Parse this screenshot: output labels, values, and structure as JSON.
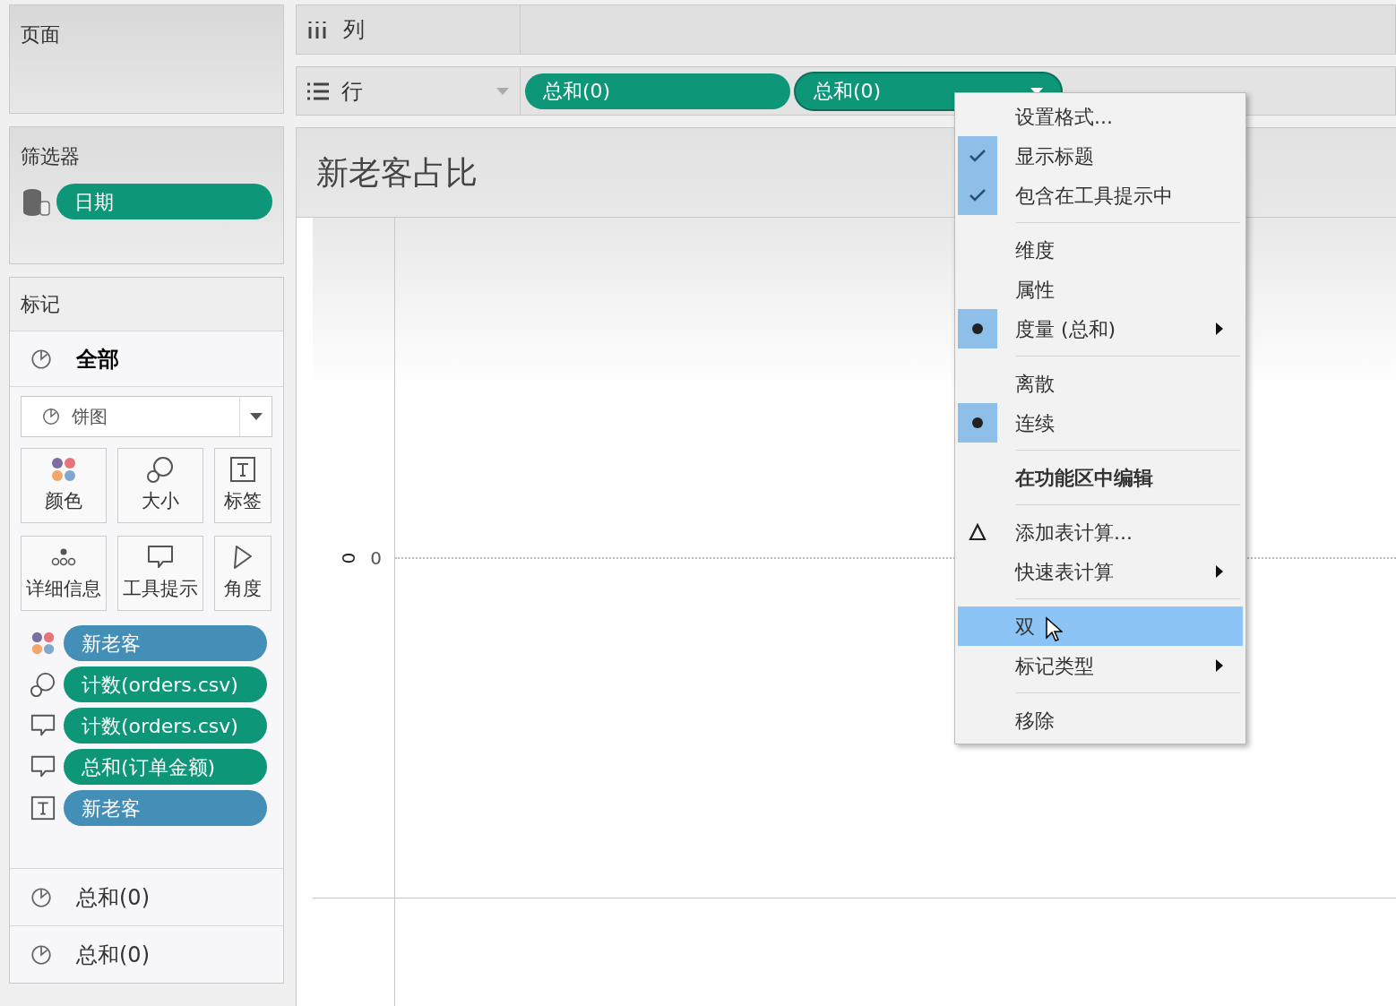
{
  "pages_card": {
    "title": "页面"
  },
  "filters_card": {
    "title": "筛选器",
    "pills": [
      {
        "text": "日期",
        "color": "#0e9679"
      }
    ]
  },
  "marks_card": {
    "title": "标记",
    "sections": [
      {
        "label": "全部",
        "selected": true
      },
      {
        "label": "总和(0)",
        "selected": false
      },
      {
        "label": "总和(0)",
        "selected": false
      }
    ],
    "mark_type": {
      "value": "饼图"
    },
    "properties": [
      {
        "kind": "color",
        "label": "颜色"
      },
      {
        "kind": "size",
        "label": "大小"
      },
      {
        "kind": "label",
        "label": "标签"
      },
      {
        "kind": "detail",
        "label": "详细信息"
      },
      {
        "kind": "tooltip",
        "label": "工具提示"
      },
      {
        "kind": "angle",
        "label": "角度"
      }
    ],
    "fields": [
      {
        "kind": "color",
        "text": "新老客",
        "color": "#448fb8"
      },
      {
        "kind": "size",
        "text": "计数(orders.csv)",
        "color": "#0e9679"
      },
      {
        "kind": "tooltip",
        "text": "计数(orders.csv)",
        "color": "#0e9679"
      },
      {
        "kind": "tooltip",
        "text": "总和(订单金额)",
        "color": "#0e9679"
      },
      {
        "kind": "label",
        "text": "新老客",
        "color": "#448fb8"
      }
    ]
  },
  "columns_shelf": {
    "label": "列"
  },
  "rows_shelf": {
    "label": "行",
    "pills": [
      {
        "text": "总和(0)",
        "color": "#0e9679",
        "menu_open": false
      },
      {
        "text": "总和(0)",
        "color": "#0e9679",
        "menu_open": true
      }
    ]
  },
  "view": {
    "title": "新老客占比",
    "axis_title": "0",
    "axis_tick": "0"
  },
  "context_menu": {
    "items": [
      {
        "kind": "action",
        "label": "设置格式...",
        "default": false,
        "selected": false,
        "submenu": false
      },
      {
        "kind": "check",
        "label": "显示标题",
        "checked": true,
        "default": false,
        "selected": false,
        "submenu": false
      },
      {
        "kind": "check",
        "label": "包含在工具提示中",
        "checked": true,
        "default": false,
        "selected": false,
        "submenu": false
      },
      {
        "kind": "separator"
      },
      {
        "kind": "radio",
        "label": "维度",
        "checked": false,
        "default": false,
        "selected": false,
        "submenu": false
      },
      {
        "kind": "radio",
        "label": "属性",
        "checked": false,
        "default": false,
        "selected": false,
        "submenu": false
      },
      {
        "kind": "radio",
        "label": "度量 (总和)",
        "checked": true,
        "default": false,
        "selected": false,
        "submenu": true
      },
      {
        "kind": "separator"
      },
      {
        "kind": "radio",
        "label": "离散",
        "checked": false,
        "default": false,
        "selected": false,
        "submenu": false
      },
      {
        "kind": "radio",
        "label": "连续",
        "checked": true,
        "default": false,
        "selected": false,
        "submenu": false
      },
      {
        "kind": "separator"
      },
      {
        "kind": "action",
        "label": "在功能区中编辑",
        "default": true,
        "selected": false,
        "submenu": false
      },
      {
        "kind": "separator"
      },
      {
        "kind": "calc",
        "label": "添加表计算...",
        "default": false,
        "selected": false,
        "submenu": false
      },
      {
        "kind": "action",
        "label": "快速表计算",
        "default": false,
        "selected": false,
        "submenu": true
      },
      {
        "kind": "separator"
      },
      {
        "kind": "action",
        "label": "双",
        "default": false,
        "selected": true,
        "submenu": false
      },
      {
        "kind": "action",
        "label": "标记类型",
        "default": false,
        "selected": false,
        "submenu": true
      },
      {
        "kind": "separator"
      },
      {
        "kind": "action",
        "label": "移除",
        "default": false,
        "selected": false,
        "submenu": false
      }
    ]
  }
}
